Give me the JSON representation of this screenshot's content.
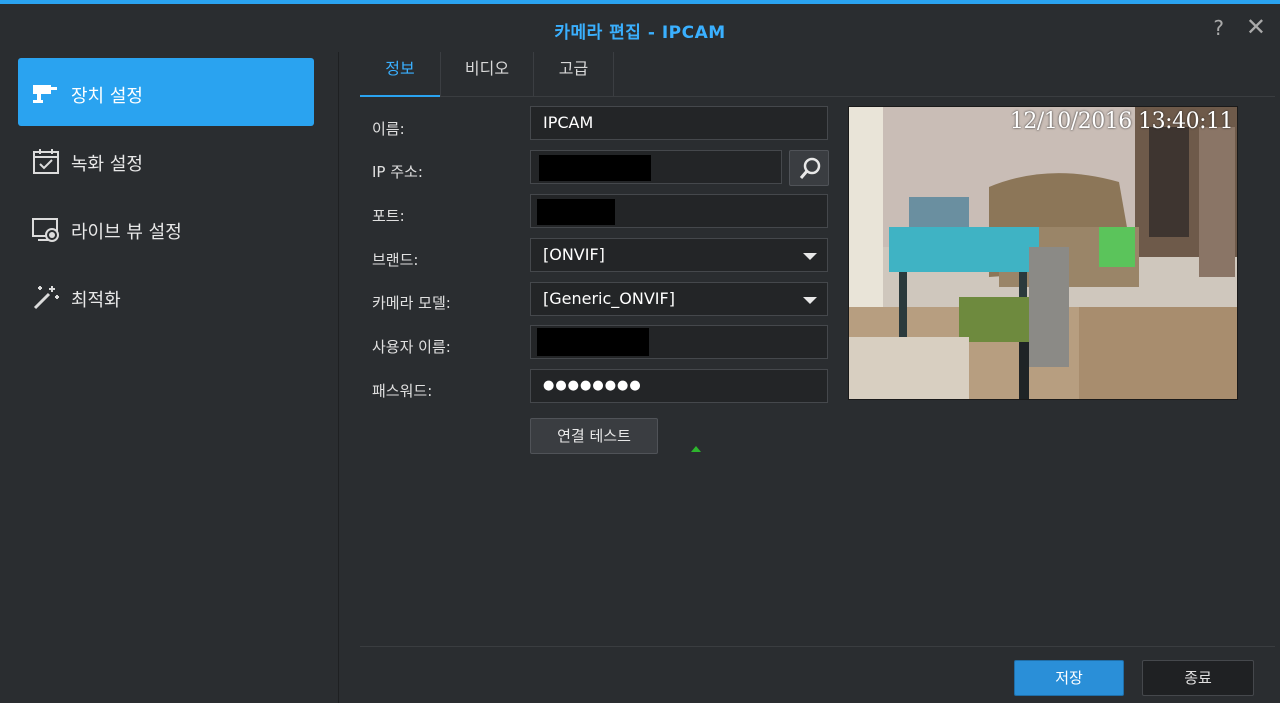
{
  "window": {
    "title_prefix": "카메라 편집",
    "title_sep": " - ",
    "title_name": "IPCAM",
    "help_glyph": "?",
    "close_glyph": "✕"
  },
  "sidebar": {
    "items": [
      {
        "label": "장치 설정",
        "icon": "camera-icon",
        "active": true
      },
      {
        "label": "녹화 설정",
        "icon": "calendar-check-icon",
        "active": false
      },
      {
        "label": "라이브 뷰 설정",
        "icon": "monitor-record-icon",
        "active": false
      },
      {
        "label": "최적화",
        "icon": "magic-wand-icon",
        "active": false
      }
    ]
  },
  "tabs": [
    {
      "label": "정보",
      "active": true
    },
    {
      "label": "비디오",
      "active": false
    },
    {
      "label": "고급",
      "active": false
    }
  ],
  "form": {
    "name": {
      "label": "이름:",
      "value": "IPCAM"
    },
    "ip": {
      "label": "IP 주소:",
      "value": ""
    },
    "port": {
      "label": "포트:",
      "value": ""
    },
    "brand": {
      "label": "브랜드:",
      "value": "[ONVIF]"
    },
    "model": {
      "label": "카메라 모델:",
      "value": "[Generic_ONVIF]"
    },
    "username": {
      "label": "사용자 이름:",
      "value": ""
    },
    "password": {
      "label": "패스워드:",
      "value": "●●●●●●●●"
    },
    "test_button": "연결 테스트"
  },
  "preview": {
    "timestamp": "12/10/2016 13:40:11"
  },
  "footer": {
    "save": "저장",
    "close": "종료"
  },
  "colors": {
    "accent": "#2aa3f0",
    "background": "#2a2d30"
  }
}
